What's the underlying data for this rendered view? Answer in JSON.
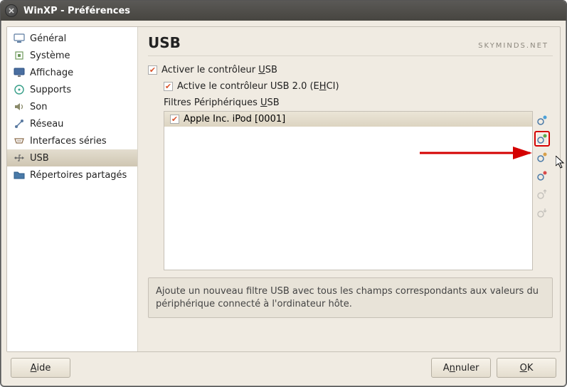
{
  "window": {
    "title": "WinXP - Préférences"
  },
  "brand": "SKYMINDS.NET",
  "sidebar": {
    "items": [
      {
        "label": "Général"
      },
      {
        "label": "Système"
      },
      {
        "label": "Affichage"
      },
      {
        "label": "Supports"
      },
      {
        "label": "Son"
      },
      {
        "label": "Réseau"
      },
      {
        "label": "Interfaces séries"
      },
      {
        "label": "USB"
      },
      {
        "label": "Répertoires partagés"
      }
    ],
    "selected_index": 7
  },
  "page": {
    "title": "USB",
    "enable_usb_prefix": "Activer le contrôleur ",
    "enable_usb_uchar": "U",
    "enable_usb_suffix": "SB",
    "enable_usb_checked": true,
    "enable_ehci_prefix": "Active le contrôleur USB 2.0 (E",
    "enable_ehci_uchar": "H",
    "enable_ehci_suffix": "CI)",
    "enable_ehci_checked": true,
    "filters_label_prefix": "Filtres Périphériques ",
    "filters_label_uchar": "U",
    "filters_label_suffix": "SB",
    "filters": [
      {
        "label": "Apple Inc. iPod [0001]",
        "checked": true
      }
    ],
    "description": "Ajoute un nouveau filtre USB avec tous les champs correspondants aux valeurs du périphérique connecté à l'ordinateur hôte."
  },
  "buttons": {
    "help_uchar": "A",
    "help_suffix": "ide",
    "cancel_prefix": "A",
    "cancel_uchar": "n",
    "cancel_suffix": "nuler",
    "ok_uchar": "O",
    "ok_suffix": "K"
  }
}
